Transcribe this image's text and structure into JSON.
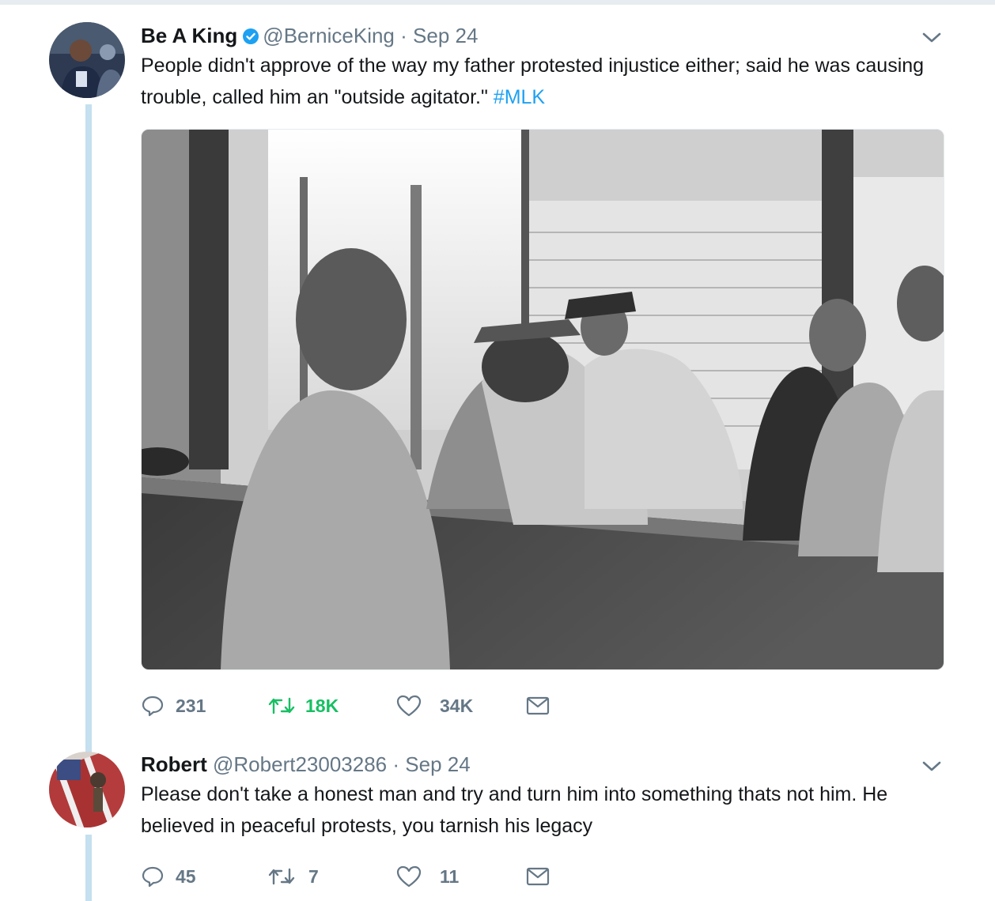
{
  "tweet1": {
    "name": "Be A King",
    "handle": "@BerniceKing",
    "separator": "·",
    "date": "Sep 24",
    "text": "People didn't approve of the way my father protested injustice either; said he was causing trouble, called him an \"outside agitator.\"",
    "hashtag": "#MLK",
    "actions": {
      "replies": "231",
      "retweets": "18K",
      "likes": "34K"
    }
  },
  "tweet2": {
    "name": "Robert",
    "handle": "@Robert23003286",
    "separator": "·",
    "date": "Sep 24",
    "text": "Please don't take a honest man and try and turn him into something thats not him. He believed in peaceful protests, you tarnish his legacy",
    "actions": {
      "replies": "45",
      "retweets": "7",
      "likes": "11"
    }
  },
  "colors": {
    "accent": "#1da1f2",
    "retweet_active": "#17bf63",
    "muted": "#657786",
    "thread_line": "#c5e0ef"
  },
  "icons": [
    "reply-icon",
    "retweet-icon",
    "like-icon",
    "direct-message-icon",
    "verified-badge-icon",
    "chevron-down-icon"
  ]
}
